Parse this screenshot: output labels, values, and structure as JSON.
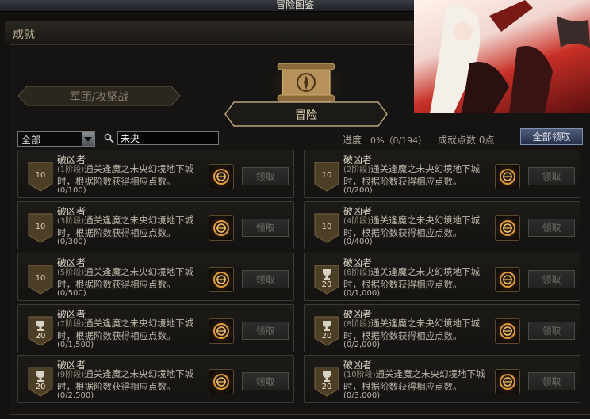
{
  "window": {
    "title": "冒险图鉴"
  },
  "section": {
    "title": "成就"
  },
  "tabs": {
    "legion": "军团/攻坚战",
    "adventure": "冒险"
  },
  "filter": {
    "selected": "全部"
  },
  "search": {
    "value": "未央"
  },
  "progress": {
    "label": "进度",
    "value": "0%（0/194）"
  },
  "points": {
    "label": "成就点数 0点"
  },
  "claim_all": {
    "label": "全部领取"
  },
  "achievements": [
    {
      "name": "破凶者",
      "stage": "(1阶段)",
      "desc": "通关逢魔之未央幻境地下城时，根据阶数获得相应点数。",
      "progress": "(0/100)",
      "badge": "10",
      "badge_type": "points",
      "claim": "领取"
    },
    {
      "name": "破凶者",
      "stage": "(2阶段)",
      "desc": "通关逢魔之未央幻境地下城时，根据阶数获得相应点数。",
      "progress": "(0/200)",
      "badge": "10",
      "badge_type": "points",
      "claim": "领取"
    },
    {
      "name": "破凶者",
      "stage": "(3阶段)",
      "desc": "通关逢魔之未央幻境地下城时，根据阶数获得相应点数。",
      "progress": "(0/300)",
      "badge": "10",
      "badge_type": "points",
      "claim": "领取"
    },
    {
      "name": "破凶者",
      "stage": "(4阶段)",
      "desc": "通关逢魔之未央幻境地下城时，根据阶数获得相应点数。",
      "progress": "(0/400)",
      "badge": "10",
      "badge_type": "points",
      "claim": "领取"
    },
    {
      "name": "破凶者",
      "stage": "(5阶段)",
      "desc": "通关逢魔之未央幻境地下城时，根据阶数获得相应点数。",
      "progress": "(0/500)",
      "badge": "10",
      "badge_type": "points",
      "claim": "领取"
    },
    {
      "name": "破凶者",
      "stage": "(6阶段)",
      "desc": "通关逢魔之未央幻境地下城时，根据阶数获得相应点数。",
      "progress": "(0/1,000)",
      "badge": "20",
      "badge_type": "trophy",
      "claim": "领取"
    },
    {
      "name": "破凶者",
      "stage": "(7阶段)",
      "desc": "通关逢魔之未央幻境地下城时，根据阶数获得相应点数。",
      "progress": "(0/1,500)",
      "badge": "20",
      "badge_type": "trophy",
      "claim": "领取"
    },
    {
      "name": "破凶者",
      "stage": "(8阶段)",
      "desc": "通关逢魔之未央幻境地下城时，根据阶数获得相应点数。",
      "progress": "(0/2,000)",
      "badge": "20",
      "badge_type": "trophy",
      "claim": "领取"
    },
    {
      "name": "破凶者",
      "stage": "(9阶段)",
      "desc": "通关逢魔之未央幻境地下城时，根据阶数获得相应点数。",
      "progress": "(0/2,500)",
      "badge": "20",
      "badge_type": "trophy",
      "claim": "领取"
    },
    {
      "name": "破凶者",
      "stage": "(10阶段)",
      "desc": "通关逢魔之未央幻境地下城时，根据阶数获得相应点数。",
      "progress": "(0/3,000)",
      "badge": "20",
      "badge_type": "trophy",
      "claim": "领取"
    }
  ],
  "icons": {
    "search": "search-icon",
    "dropdown": "chevron-down-icon",
    "reward": "reward-emblem-icon",
    "trophy": "trophy-icon"
  },
  "colors": {
    "claim_all": "#3a4560",
    "badge": "#5a4a2a",
    "text": "#c9c4b8"
  }
}
